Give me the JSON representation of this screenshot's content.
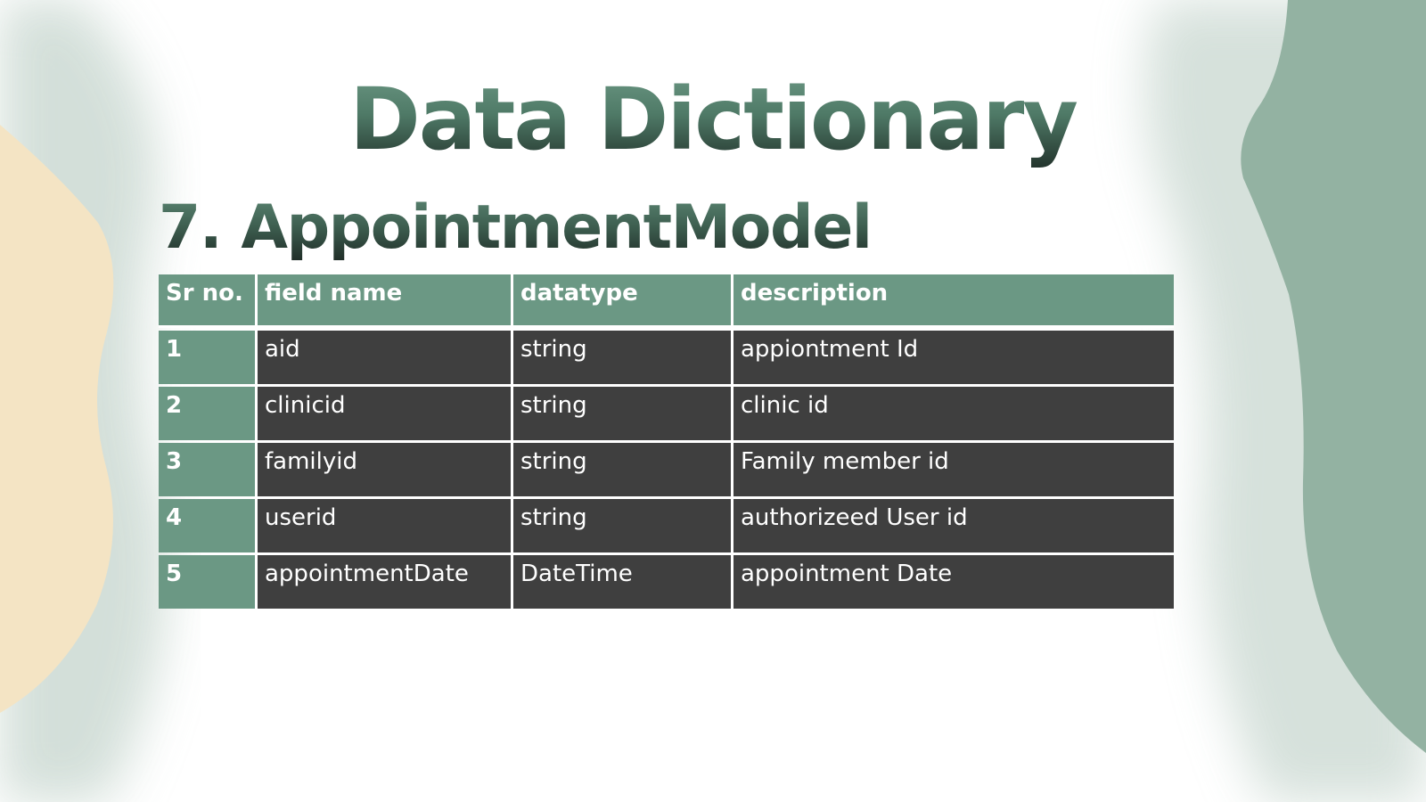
{
  "slide": {
    "title": "Data Dictionary",
    "subtitle": "7. AppointmentModel"
  },
  "table": {
    "headers": [
      "Sr no.",
      "field name",
      "datatype",
      "description"
    ],
    "rows": [
      [
        "1",
        "aid",
        "string",
        "appiontment Id"
      ],
      [
        "2",
        "clinicid",
        "string",
        "clinic id"
      ],
      [
        "3",
        "familyid",
        "string",
        "Family member id"
      ],
      [
        "4",
        "userid",
        "string",
        "authorizeed User id"
      ],
      [
        "5",
        "appointmentDate",
        "DateTime",
        "appointment Date"
      ]
    ]
  },
  "colors": {
    "accent_green": "#6b9884",
    "cell_dark": "#3f3f3f",
    "blob_green": "#93b2a2",
    "blob_cream": "#f4e4c4"
  }
}
